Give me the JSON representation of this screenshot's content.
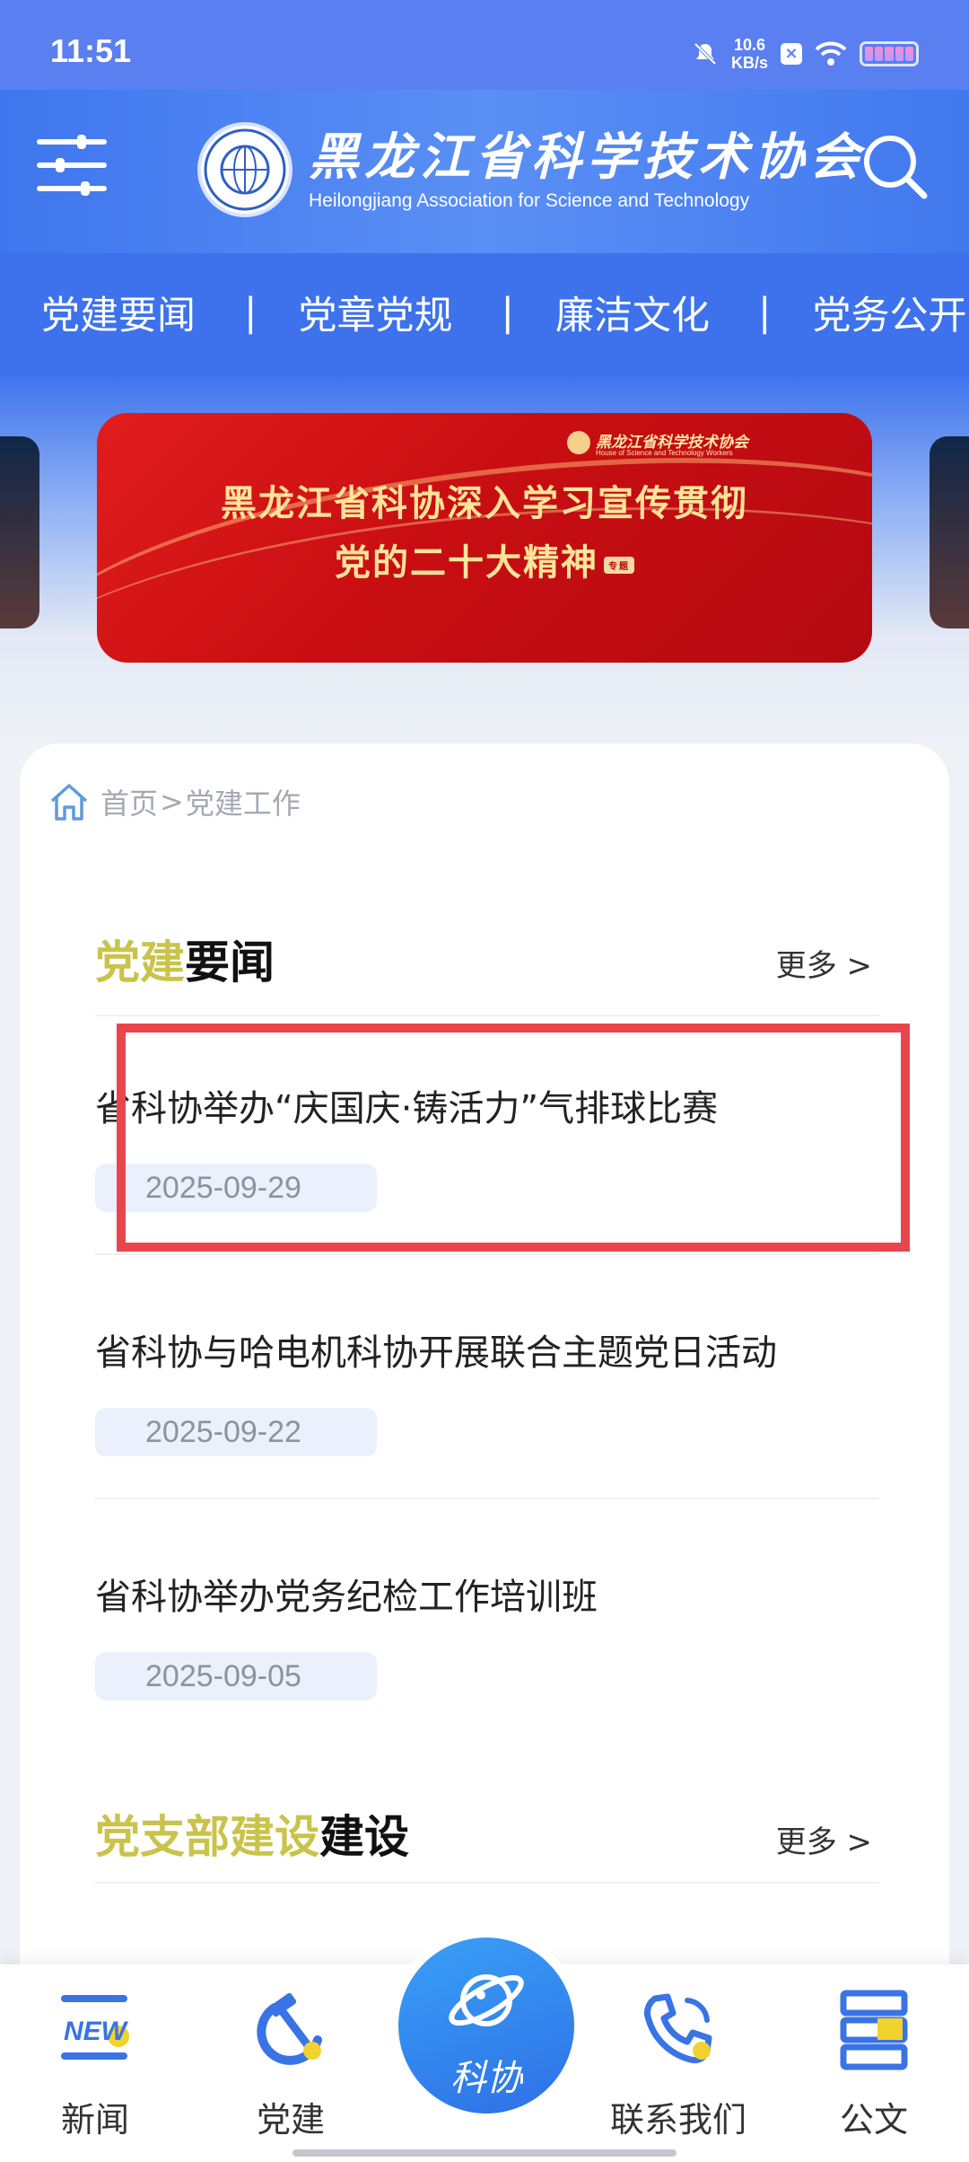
{
  "status_bar": {
    "time": "11:51",
    "net_speed": "10.6",
    "net_unit": "KB/s"
  },
  "header": {
    "org_name_cn": "黑龙江省科学技术协会",
    "org_name_en": "Heilongjiang Association for Science and Technology"
  },
  "nav": {
    "items": [
      "党建要闻",
      "党章党规",
      "廉洁文化",
      "党务公开"
    ],
    "separator": "|"
  },
  "banner": {
    "org_label": "黑龙江省科学技术协会",
    "org_label_en": "House of Science and Technology Workers",
    "line1": "黑龙江省科协深入学习宣传贯彻",
    "line2": "党的二十大精神",
    "tag": "专题"
  },
  "breadcrumb": {
    "home": "首页",
    "sep": ">",
    "current": "党建工作"
  },
  "section1": {
    "title_highlight": "党建",
    "title_rest": "要闻",
    "more": "更多 >",
    "news": [
      {
        "title": "省科协举办“庆国庆·铸活力”气排球比赛",
        "date": "2025-09-29"
      },
      {
        "title": "省科协与哈电机科协开展联合主题党日活动",
        "date": "2025-09-22"
      },
      {
        "title": "省科协举办党务纪检工作培训班",
        "date": "2025-09-05"
      }
    ]
  },
  "section2": {
    "title_highlight": "党支部建设",
    "title_rest": "建设",
    "more": "更多 >"
  },
  "bottom_nav": {
    "news": "新闻",
    "party": "党建",
    "center": "科协",
    "contact": "联系我们",
    "docs": "公文",
    "new_badge": "NEW"
  },
  "colors": {
    "primary": "#3d72ec",
    "highlight_yellow": "#c9c34a",
    "outline_red": "#e9454d"
  }
}
